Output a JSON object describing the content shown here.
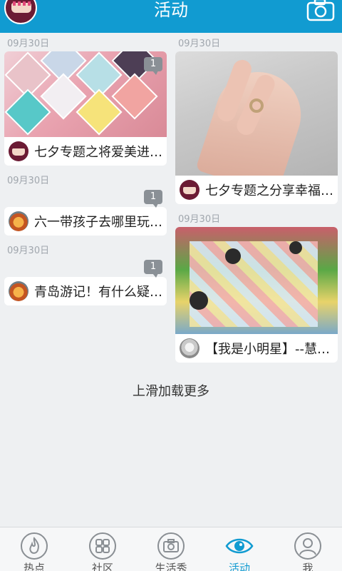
{
  "header": {
    "title": "活动"
  },
  "left_column": [
    {
      "date": "09月30日",
      "title": "七夕专题之将爱美进…",
      "comment_count": "1",
      "image": "nail-art-collage",
      "avatar": "purple"
    },
    {
      "date": "09月30日",
      "title": "六一带孩子去哪里玩…",
      "comment_count": "1",
      "avatar": "orange"
    },
    {
      "date": "09月30日",
      "title": "青岛游记！有什么疑…",
      "comment_count": "1",
      "avatar": "orange"
    }
  ],
  "right_column": [
    {
      "date": "09月30日",
      "title": "七夕专题之分享幸福…",
      "image": "ring-on-hand",
      "avatar": "purple"
    },
    {
      "date": "09月30日",
      "title": "【我是小明星】--慧…",
      "image": "children-painting",
      "avatar": "gray"
    }
  ],
  "load_more": "上滑加载更多",
  "tabs": [
    {
      "label": "热点",
      "icon": "flame-icon",
      "active": false
    },
    {
      "label": "社区",
      "icon": "grid-icon",
      "active": false
    },
    {
      "label": "生活秀",
      "icon": "camera-icon",
      "active": false
    },
    {
      "label": "活动",
      "icon": "eye-icon",
      "active": true
    },
    {
      "label": "我",
      "icon": "person-icon",
      "active": false
    }
  ],
  "colors": {
    "brand": "#119bd1",
    "badge": "#8a9096",
    "background": "#eef0f2"
  }
}
